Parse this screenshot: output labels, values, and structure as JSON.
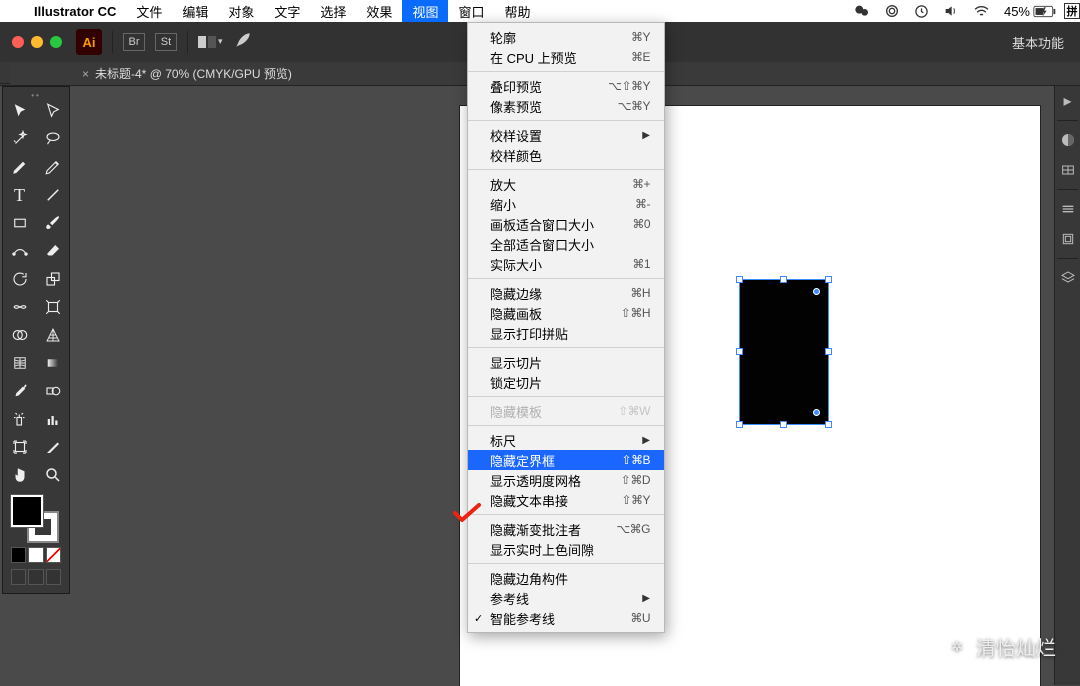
{
  "menubar": {
    "app_name": "Illustrator CC",
    "items": [
      "文件",
      "编辑",
      "对象",
      "文字",
      "选择",
      "效果",
      "视图",
      "窗口",
      "帮助"
    ],
    "active_index": 6,
    "battery": "45%"
  },
  "apptop": {
    "logo": "Ai",
    "badge1": "Br",
    "badge2": "St",
    "right_label": "基本功能"
  },
  "doc_tab": {
    "close": "×",
    "title": "未标题-4* @ 70% (CMYK/GPU 预览)"
  },
  "view_menu": {
    "groups": [
      [
        {
          "label": "轮廓",
          "shortcut": "⌘Y"
        },
        {
          "label": "在 CPU 上预览",
          "shortcut": "⌘E"
        }
      ],
      [
        {
          "label": "叠印预览",
          "shortcut": "⌥⇧⌘Y"
        },
        {
          "label": "像素预览",
          "shortcut": "⌥⌘Y"
        }
      ],
      [
        {
          "label": "校样设置",
          "submenu": true
        },
        {
          "label": "校样颜色"
        }
      ],
      [
        {
          "label": "放大",
          "shortcut": "⌘+"
        },
        {
          "label": "缩小",
          "shortcut": "⌘-"
        },
        {
          "label": "画板适合窗口大小",
          "shortcut": "⌘0"
        },
        {
          "label": "全部适合窗口大小"
        },
        {
          "label": "实际大小",
          "shortcut": "⌘1"
        }
      ],
      [
        {
          "label": "隐藏边缘",
          "shortcut": "⌘H"
        },
        {
          "label": "隐藏画板",
          "shortcut": "⇧⌘H"
        },
        {
          "label": "显示打印拼贴"
        }
      ],
      [
        {
          "label": "显示切片"
        },
        {
          "label": "锁定切片"
        }
      ],
      [
        {
          "label": "隐藏模板",
          "shortcut": "⇧⌘W",
          "disabled": true
        }
      ],
      [
        {
          "label": "标尺",
          "submenu": true
        },
        {
          "label": "隐藏定界框",
          "shortcut": "⇧⌘B",
          "selected": true
        },
        {
          "label": "显示透明度网格",
          "shortcut": "⇧⌘D"
        },
        {
          "label": "隐藏文本串接",
          "shortcut": "⇧⌘Y"
        }
      ],
      [
        {
          "label": "隐藏渐变批注者",
          "shortcut": "⌥⌘G"
        },
        {
          "label": "显示实时上色间隙"
        }
      ],
      [
        {
          "label": "隐藏边角构件"
        },
        {
          "label": "参考线",
          "submenu": true
        },
        {
          "label": "智能参考线",
          "shortcut": "⌘U",
          "checked": true
        }
      ]
    ]
  },
  "watermark": "清怡灿烂"
}
